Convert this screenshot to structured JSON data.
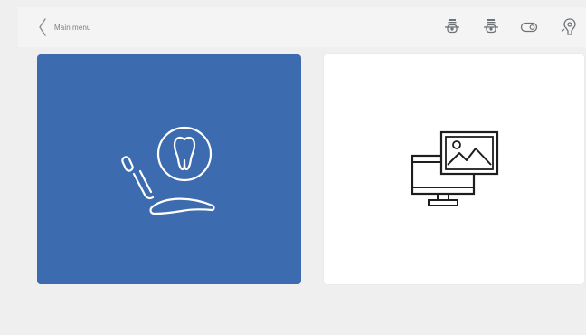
{
  "header": {
    "back_label": "Main menu"
  },
  "toolbar": {
    "icons": [
      "device-plug-icon",
      "device-plug-alt-icon",
      "toggle-icon",
      "sensor-icon"
    ]
  },
  "tiles": [
    {
      "name": "treatment",
      "icon": "dental-chair-tooth-icon",
      "color": "#3c6baf"
    },
    {
      "name": "images",
      "icon": "monitor-image-icon",
      "color": "#ffffff"
    }
  ],
  "colors": {
    "accent": "#3c6baf",
    "background": "#efefef",
    "icon_gray": "#6f7378"
  }
}
